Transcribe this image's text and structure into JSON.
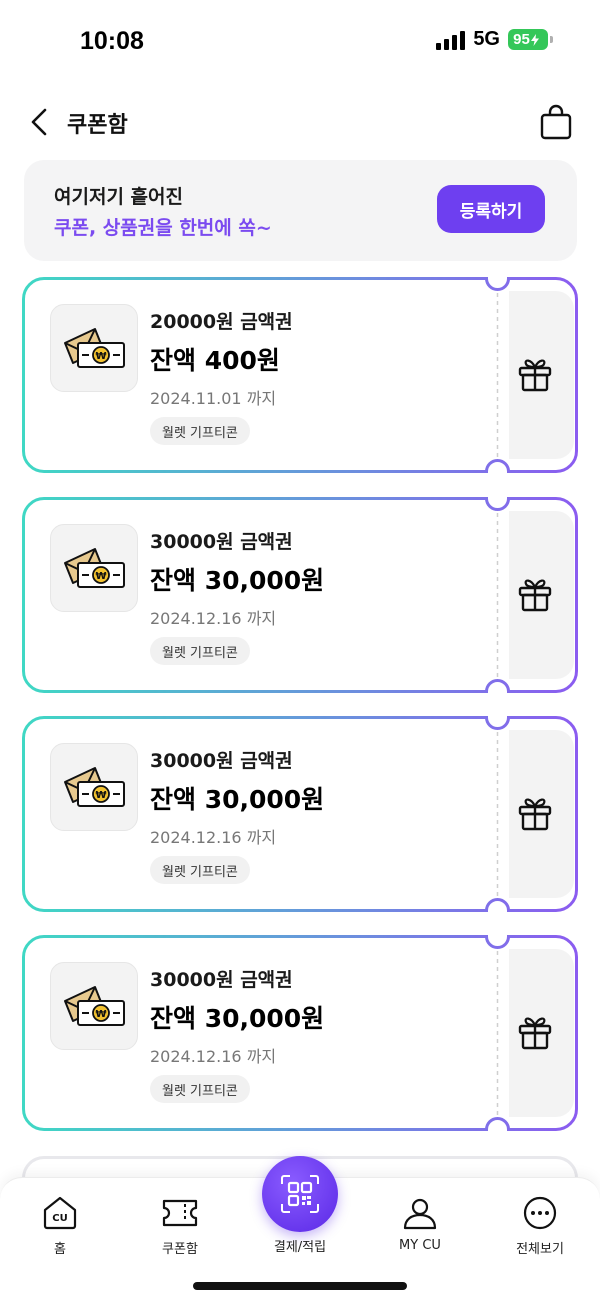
{
  "status_bar": {
    "time": "10:08",
    "network": "5G",
    "battery": "95"
  },
  "header": {
    "title": "쿠폰함"
  },
  "banner": {
    "line1": "여기저기 흩어진",
    "line2": "쿠폰, 상품권을 한번에 쏙~",
    "button_label": "등록하기"
  },
  "coupons": [
    {
      "name": "20000원 금액권",
      "balance": "잔액 400원",
      "expiry": "2024.11.01 까지",
      "tag": "월렛 기프티콘"
    },
    {
      "name": "30000원 금액권",
      "balance": "잔액 30,000원",
      "expiry": "2024.12.16 까지",
      "tag": "월렛 기프티콘"
    },
    {
      "name": "30000원 금액권",
      "balance": "잔액 30,000원",
      "expiry": "2024.12.16 까지",
      "tag": "월렛 기프티콘"
    },
    {
      "name": "30000원 금액권",
      "balance": "잔액 30,000원",
      "expiry": "2024.12.16 까지",
      "tag": "월렛 기프티콘"
    }
  ],
  "bottom_nav": {
    "home": "홈",
    "coupons": "쿠폰함",
    "pay": "결제/적립",
    "my_cu": "MY CU",
    "more": "전체보기",
    "home_icon_text": "CU"
  },
  "colors": {
    "accent": "#6e3ff0",
    "gradient_start": "#3fd8c4",
    "gradient_end": "#8b5cf0",
    "battery": "#34c759"
  }
}
